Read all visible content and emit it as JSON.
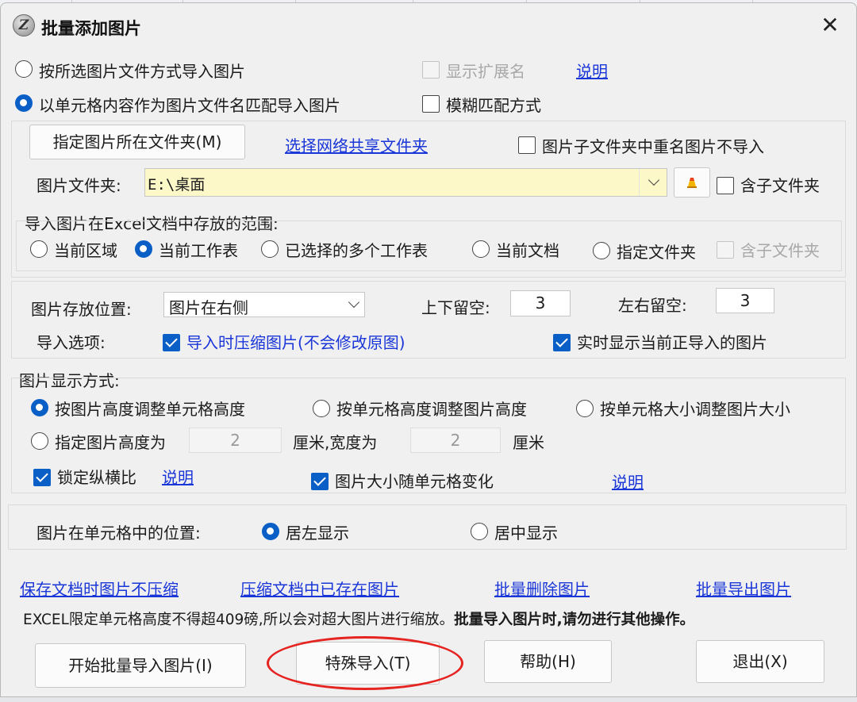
{
  "window": {
    "title": "批量添加图片",
    "close_symbol": "✕",
    "logo_glyph": "Z"
  },
  "import_mode": {
    "by_selected_files": "按所选图片文件方式导入图片",
    "by_cell_content": "以单元格内容作为图片文件名匹配导入图片",
    "selected": "by_cell_content",
    "show_extension": "显示扩展名",
    "show_extension_link": "说明",
    "fuzzy_match": "模糊匹配方式"
  },
  "folder": {
    "specify_button": "指定图片所在文件夹(M)",
    "network_link": "选择网络共享文件夹",
    "skip_duplicates": "图片子文件夹中重名图片不导入",
    "label": "图片文件夹:",
    "value": "E:\\桌面",
    "include_sub": "含子文件夹"
  },
  "scope": {
    "legend": "导入图片在Excel文档中存放的范围:",
    "options": [
      "当前区域",
      "当前工作表",
      "已选择的多个工作表",
      "当前文档",
      "指定文件夹"
    ],
    "selected": "当前工作表",
    "include_sub": "含子文件夹"
  },
  "placement": {
    "position_label": "图片存放位置:",
    "position_value": "图片在右侧",
    "vertical_margin_label": "上下留空:",
    "vertical_margin_value": "3",
    "horizontal_margin_label": "左右留空:",
    "horizontal_margin_value": "3",
    "options_label": "导入选项:",
    "compress_on_import": "导入时压缩图片(不会修改原图)",
    "show_realtime": "实时显示当前正导入的图片"
  },
  "display": {
    "legend": "图片显示方式:",
    "mode_1": "按图片高度调整单元格高度",
    "mode_2": "按单元格高度调整图片高度",
    "mode_3": "按单元格大小调整图片大小",
    "mode_4": "指定图片高度为",
    "height_value": "2",
    "cm_width": "厘米,宽度为",
    "width_value": "2",
    "cm": "厘米",
    "lock_ratio": "锁定纵横比",
    "lock_ratio_link": "说明",
    "resize_with_cell": "图片大小随单元格变化",
    "resize_link": "说明"
  },
  "cell_position": {
    "label": "图片在单元格中的位置:",
    "left": "居左显示",
    "center": "居中显示"
  },
  "links": {
    "no_compress_on_save": "保存文档时图片不压缩",
    "compress_existing": "压缩文档中已存在图片",
    "batch_delete": "批量删除图片",
    "batch_export": "批量导出图片"
  },
  "notice": {
    "normal": "EXCEL限定单元格高度不得超409磅,所以会对超大图片进行缩放。",
    "bold": "批量导入图片时,请勿进行其他操作。"
  },
  "buttons": {
    "start": "开始批量导入图片(I)",
    "special": "特殊导入(T)",
    "help": "帮助(H)",
    "exit": "退出(X)"
  },
  "colors": {
    "accent": "#0a5fc7",
    "link": "#1a36d8",
    "highlight_annotation": "#e52421",
    "folder_field_bg": "#fdf8c8"
  }
}
